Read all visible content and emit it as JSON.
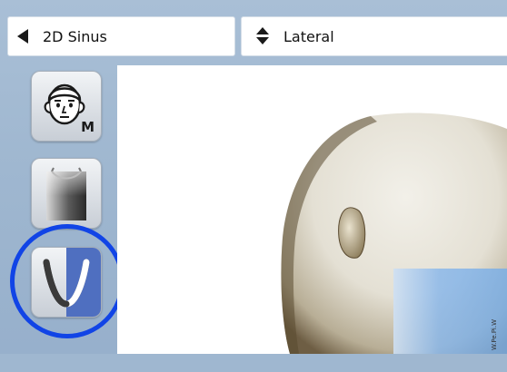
{
  "toolbar": {
    "mode_select": {
      "value": "2D Sinus"
    },
    "view_select": {
      "value": "Lateral"
    }
  },
  "tools": {
    "patient_size": {
      "badge": "M",
      "icon": "head-icon"
    },
    "density": {
      "icon": "density-icon"
    },
    "arch": {
      "icon": "arch-icon"
    }
  },
  "canvas": {
    "side_text": "W.Pe.Pi.W"
  },
  "colors": {
    "accent_ring": "#1144e6",
    "panel_bg": "#a9bfd6",
    "arch_blue": "#4f6fc0",
    "beam_blue": "#8bb8ea"
  }
}
